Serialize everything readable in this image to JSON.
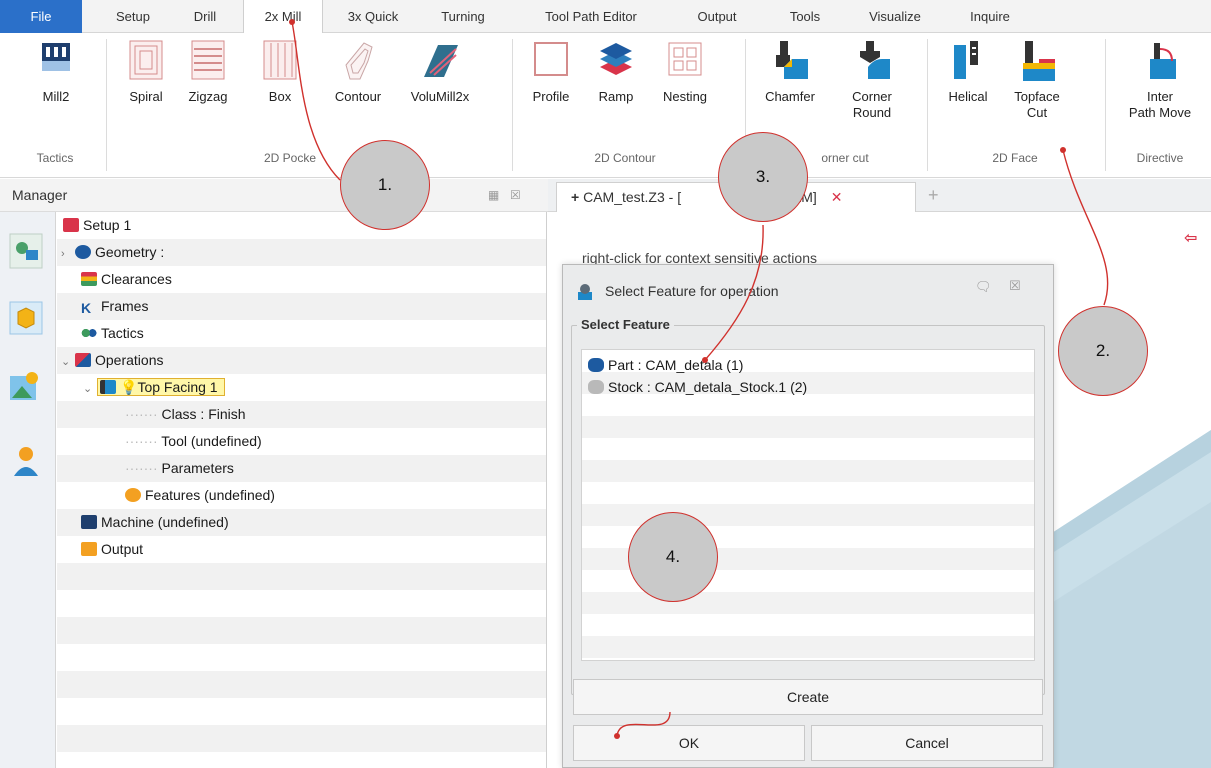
{
  "menu": {
    "tabs": [
      "File",
      "Setup",
      "Drill",
      "2x Mill",
      "3x Quick",
      "Turning",
      "Tool Path Editor",
      "Output",
      "Tools",
      "Visualize",
      "Inquire"
    ],
    "active": "2x Mill"
  },
  "ribbon": {
    "buttons": {
      "mill2": "Mill2",
      "spiral": "Spiral",
      "zigzag": "Zigzag",
      "box": "Box",
      "contour": "Contour",
      "volumill": "VoluMill2x",
      "profile": "Profile",
      "ramp": "Ramp",
      "nesting": "Nesting",
      "chamfer": "Chamfer",
      "corner_round_1": "Corner",
      "corner_round_2": "Round",
      "helical": "Helical",
      "topface_1": "Topface",
      "topface_2": "Cut",
      "inter_1": "Inter",
      "inter_2": "Path Move"
    },
    "groups": {
      "tactics": "Tactics",
      "pocket": "2D Pocke",
      "contour": "2D Contour",
      "corner": "orner cut",
      "face": "2D Face",
      "directive": "Directive"
    }
  },
  "manager": {
    "title": "Manager",
    "tree": {
      "setup": "Setup 1",
      "geometry": "Geometry :",
      "clearances": "Clearances",
      "frames": "Frames",
      "tactics": "Tactics",
      "operations": "Operations",
      "top_facing": "Top Facing 1",
      "class": "Class : Finish",
      "tool": "Tool (undefined)",
      "parameters": "Parameters",
      "features": "Features (undefined)",
      "machine": "Machine (undefined)",
      "output": "Output"
    }
  },
  "document": {
    "tab_a": "CAM_test.Z3 - [",
    "tab_b": "la_CAM]",
    "hint": "right-click for context sensitive actions"
  },
  "dialog": {
    "title": "Select Feature for operation",
    "group_label": "Select Feature",
    "items": [
      "Part : CAM_detala (1)",
      "Stock : CAM_detala_Stock.1 (2)"
    ],
    "create": "Create",
    "ok": "OK",
    "cancel": "Cancel"
  },
  "callouts": [
    "1.",
    "2.",
    "3.",
    "4."
  ],
  "colors": {
    "file_tab": "#2b70c9",
    "annotation_red": "#d0312d",
    "callout_fill": "#c9c9c9",
    "viewport_part": "#c9dfe9"
  },
  "icons": [
    "mill2-icon",
    "spiral-icon",
    "zigzag-icon",
    "box-icon",
    "contour-icon",
    "volumill-icon",
    "profile-icon",
    "ramp-icon",
    "nesting-icon",
    "chamfer-icon",
    "corner-round-icon",
    "helical-icon",
    "topface-cut-icon",
    "inter-path-move-icon",
    "close-icon",
    "plus-icon",
    "pin-icon",
    "exit-icon"
  ]
}
